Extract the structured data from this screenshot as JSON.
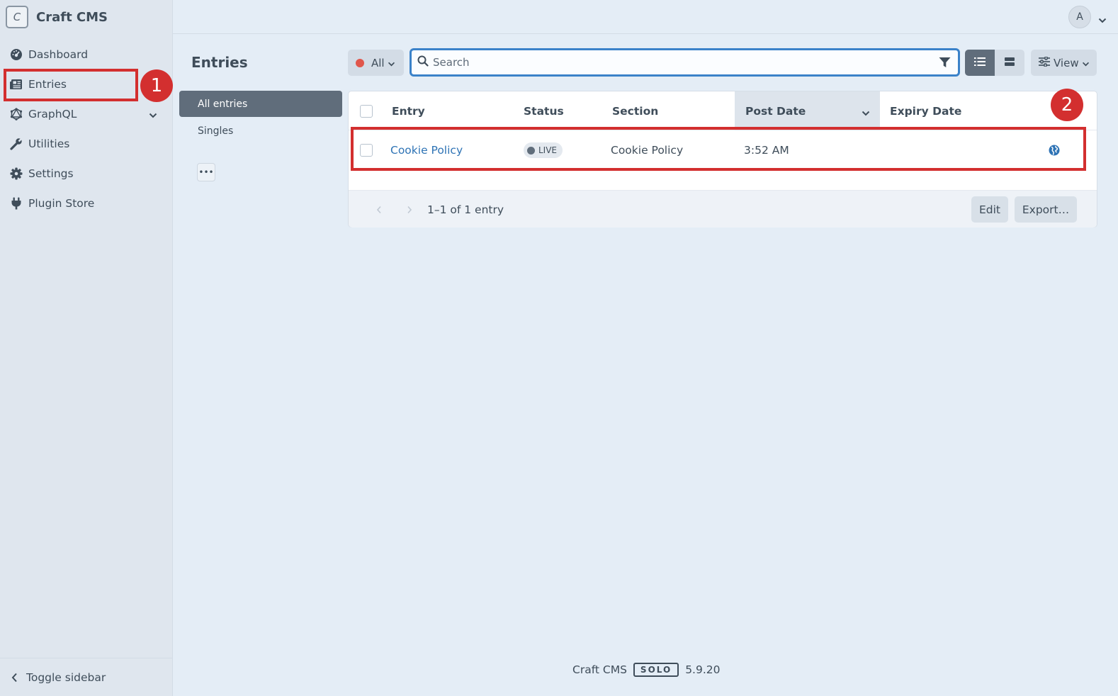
{
  "app": {
    "name": "Craft CMS",
    "logo_letter": "C"
  },
  "sidebar": {
    "items": [
      {
        "label": "Dashboard",
        "icon": "dashboard-icon"
      },
      {
        "label": "Entries",
        "icon": "newspaper-icon"
      },
      {
        "label": "GraphQL",
        "icon": "graphql-icon"
      },
      {
        "label": "Utilities",
        "icon": "wrench-icon"
      },
      {
        "label": "Settings",
        "icon": "gear-icon"
      },
      {
        "label": "Plugin Store",
        "icon": "plug-icon"
      }
    ],
    "toggle_label": "Toggle sidebar"
  },
  "user": {
    "avatar_letter": "A"
  },
  "page": {
    "title": "Entries"
  },
  "sources": {
    "items": [
      {
        "label": "All entries"
      },
      {
        "label": "Singles"
      }
    ],
    "more_label": "•••"
  },
  "toolbar": {
    "status_label": "All",
    "search_placeholder": "Search",
    "view_label": "View"
  },
  "table": {
    "columns": [
      "Entry",
      "Status",
      "Section",
      "Post Date",
      "Expiry Date"
    ],
    "rows": [
      {
        "entry": "Cookie Policy",
        "status": "LIVE",
        "section": "Cookie Policy",
        "post_date": "3:52 AM",
        "expiry_date": ""
      }
    ],
    "pagination": "1–1 of 1 entry",
    "edit_label": "Edit",
    "export_label": "Export…"
  },
  "annotations": {
    "marker1": "1",
    "marker2": "2"
  },
  "footer": {
    "product": "Craft CMS",
    "edition": "SOLO",
    "version": "5.9.20"
  },
  "colors": {
    "accent": "#3b82c9",
    "highlight": "#d32f2f",
    "link": "#2e73b5"
  }
}
